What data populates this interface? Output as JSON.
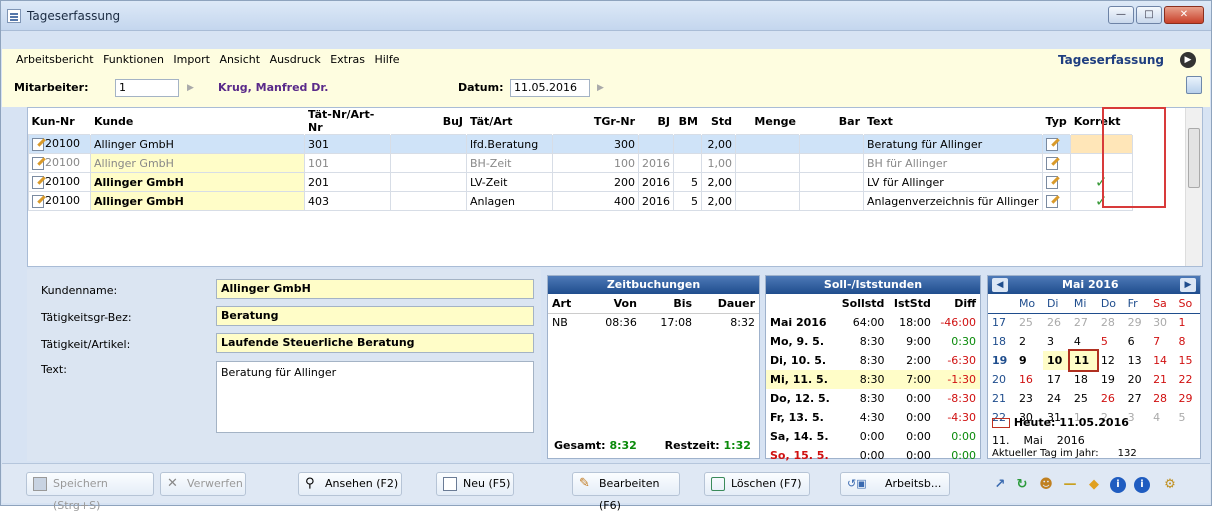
{
  "window": {
    "title": "Tageserfassung",
    "controls": [
      "minimize",
      "maximize",
      "close"
    ]
  },
  "menu": {
    "items": [
      "Arbeitsbericht",
      "Funktionen",
      "Import",
      "Ansicht",
      "Ausdruck",
      "Extras",
      "Hilfe"
    ],
    "app_title": "Tageserfassung"
  },
  "filters": {
    "mitarbeiter_label": "Mitarbeiter:",
    "mitarbeiter_value": "1",
    "mitarbeiter_name": "Krug, Manfred Dr.",
    "datum_label": "Datum:",
    "datum_value": "11.05.2016"
  },
  "grid": {
    "columns": [
      "Kun-Nr",
      "Kunde",
      "Tät-Nr/Art-Nr",
      "BuJ",
      "Tät/Art",
      "TGr-Nr",
      "BJ",
      "BM",
      "Std",
      "Menge",
      "Bar",
      "Text",
      "Typ",
      "Korrekt"
    ],
    "rows": [
      {
        "kunnr": "20100",
        "kunde": "Allinger GmbH",
        "taetnr": "301",
        "buj": "",
        "taet": "lfd.Beratung",
        "tgr": "300",
        "bj": "",
        "bm": "",
        "std": "2,00",
        "menge": "",
        "bar": "",
        "text": "Beratung für Allinger",
        "korrekt": ""
      },
      {
        "kunnr": "20100",
        "kunde": "Allinger GmbH",
        "taetnr": "101",
        "buj": "",
        "taet": "BH-Zeit",
        "tgr": "100",
        "bj": "2016",
        "bm": "",
        "std": "1,00",
        "menge": "",
        "bar": "",
        "text": "BH für Allinger",
        "korrekt": ""
      },
      {
        "kunnr": "20100",
        "kunde": "Allinger GmbH",
        "taetnr": "201",
        "buj": "",
        "taet": "LV-Zeit",
        "tgr": "200",
        "bj": "2016",
        "bm": "5",
        "std": "2,00",
        "menge": "",
        "bar": "",
        "text": "LV für Allinger",
        "korrekt": "✓"
      },
      {
        "kunnr": "20100",
        "kunde": "Allinger GmbH",
        "taetnr": "403",
        "buj": "",
        "taet": "Anlagen",
        "tgr": "400",
        "bj": "2016",
        "bm": "5",
        "std": "2,00",
        "menge": "",
        "bar": "",
        "text": "Anlagenverzeichnis für Allinger",
        "korrekt": "✓"
      }
    ]
  },
  "details": {
    "kundenname_label": "Kundenname:",
    "kundenname": "Allinger GmbH",
    "taetgr_label": "Tätigkeitsgr-Bez:",
    "taetgr": "Beratung",
    "taet_label": "Tätigkeit/Artikel:",
    "taet": "Laufende Steuerliche Beratung",
    "text_label": "Text:",
    "text": "Beratung für Allinger"
  },
  "zeitbuchungen": {
    "title": "Zeitbuchungen",
    "headers": [
      "Art",
      "Von",
      "Bis",
      "Dauer"
    ],
    "rows": [
      [
        "NB",
        "08:36",
        "17:08",
        "8:32"
      ]
    ],
    "gesamt_label": "Gesamt:",
    "gesamt": "8:32",
    "rest_label": "Restzeit:",
    "rest": "1:32"
  },
  "sollist": {
    "title": "Soll-/Iststunden",
    "headers": [
      "",
      "Sollstd",
      "IstStd",
      "Diff"
    ],
    "rows": [
      [
        "Mai 2016",
        "64:00",
        "18:00",
        "-46:00"
      ],
      [
        "Mo, 9. 5.",
        "8:30",
        "9:00",
        "0:30"
      ],
      [
        "Di, 10. 5.",
        "8:30",
        "2:00",
        "-6:30"
      ],
      [
        "Mi, 11. 5.",
        "8:30",
        "7:00",
        "-1:30"
      ],
      [
        "Do, 12. 5.",
        "8:30",
        "0:00",
        "-8:30"
      ],
      [
        "Fr, 13. 5.",
        "4:30",
        "0:00",
        "-4:30"
      ],
      [
        "Sa, 14. 5.",
        "0:00",
        "0:00",
        "0:00"
      ],
      [
        "So, 15. 5.",
        "0:00",
        "0:00",
        "0:00"
      ]
    ]
  },
  "calendar": {
    "month": "Mai 2016",
    "weekdays": [
      "Mo",
      "Di",
      "Mi",
      "Do",
      "Fr",
      "Sa",
      "So"
    ],
    "weeks": [
      [
        "17",
        "25",
        "26",
        "27",
        "28",
        "29",
        "30",
        "1"
      ],
      [
        "18",
        "2",
        "3",
        "4",
        "5",
        "6",
        "7",
        "8"
      ],
      [
        "19",
        "9",
        "10",
        "11",
        "12",
        "13",
        "14",
        "15"
      ],
      [
        "20",
        "16",
        "17",
        "18",
        "19",
        "20",
        "21",
        "22"
      ],
      [
        "21",
        "23",
        "24",
        "25",
        "26",
        "27",
        "28",
        "29"
      ],
      [
        "22",
        "30",
        "31",
        "1",
        "2",
        "3",
        "4",
        "5"
      ]
    ],
    "today_label": "Heute: 11.05.2016",
    "day": "11.",
    "monthname": "Mai",
    "year": "2016",
    "dayinyear_label": "Aktueller Tag im Jahr:",
    "dayinyear": "132"
  },
  "toolbar": {
    "save": "Speichern (Strg+S)",
    "discard": "Verwerfen",
    "view": "Ansehen (F2)",
    "new": "Neu (F5)",
    "edit": "Bearbeiten (F6)",
    "delete": "Löschen (F7)",
    "report": "Arbeitsb..."
  },
  "colors": {
    "header_blue": "#1f4d8d",
    "highlight_yellow": "#fffdc8",
    "negative": "#d01010",
    "positive": "#0a8a0a",
    "selection": "#d83a3a"
  }
}
